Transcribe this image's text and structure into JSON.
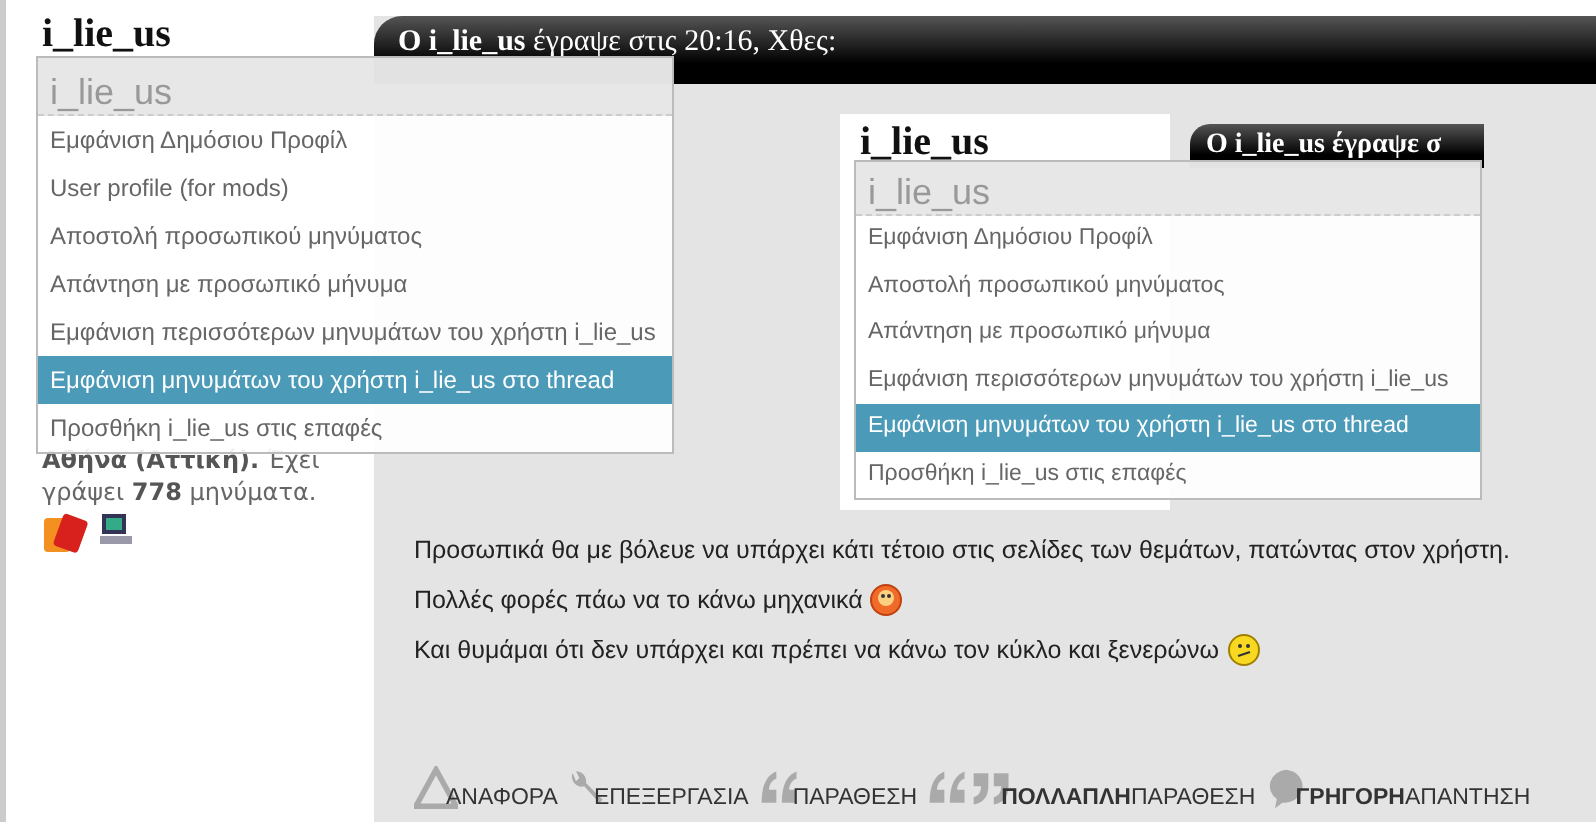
{
  "sidebar": {
    "username": "i_lie_us",
    "info": "**Αθήνα (Αττική).** Έχει γράψει **778** μηνύματα."
  },
  "user_menu": {
    "header": "i_lie_us",
    "items": [
      {
        "label": "Εμφάνιση Δημόσιου Προφίλ",
        "selected": false
      },
      {
        "label": "User profile (for mods)",
        "selected": false
      },
      {
        "label": "Αποστολή προσωπικού μηνύματος",
        "selected": false
      },
      {
        "label": "Απάντηση με προσωπικό μήνυμα",
        "selected": false
      },
      {
        "label": "Εμφάνιση περισσότερων μηνυμάτων του χρήστη i_lie_us",
        "selected": false
      },
      {
        "label": "Εμφάνιση μηνυμάτων του χρήστη i_lie_us στο thread",
        "selected": true
      },
      {
        "label": "Προσθήκη i_lie_us στις επαφές",
        "selected": false
      }
    ]
  },
  "post": {
    "header": "**Ο i_lie_us** έγραψε στις 20:16, Χθες:",
    "screenshot": {
      "username": "i_lie_us",
      "post_header": "Ο i_lie_us έγραψε σ",
      "menu": {
        "header": "i_lie_us",
        "items": [
          {
            "label": "Εμφάνιση Δημόσιου Προφίλ",
            "selected": false
          },
          {
            "label": "Αποστολή προσωπικού μηνύματος",
            "selected": false
          },
          {
            "label": "Απάντηση με προσωπικό μήνυμα",
            "selected": false
          },
          {
            "label": "Εμφάνιση περισσότερων μηνυμάτων του χρήστη i_lie_us",
            "selected": false
          },
          {
            "label": "Εμφάνιση μηνυμάτων του χρήστη i_lie_us στο thread",
            "selected": true
          },
          {
            "label": "Προσθήκη i_lie_us στις επαφές",
            "selected": false
          }
        ]
      }
    },
    "paragraphs": [
      {
        "kind": "plain",
        "text": "Προσωπικά θα με βόλευε να υπάρχει κάτι τέτοιο στις σελίδες των θεμάτων, πατώντας στον χρήστη."
      },
      {
        "kind": "embarrassed",
        "text": "Πολλές φορές πάω να το κάνω μηχανικά"
      },
      {
        "kind": "confused",
        "text": "Και θυμάμαι ότι δεν υπάρχει και πρέπει να κάνω τον κύκλο και ξενερώνω"
      }
    ],
    "buttons": [
      {
        "kind": "report",
        "label": "ΑΝΑΦΟΡΑ"
      },
      {
        "kind": "edit",
        "label": "ΕΠΕΞΕΡΓΑΣΙΑ"
      },
      {
        "kind": "quote",
        "label": "ΠΑΡΑΘΕΣΗ"
      },
      {
        "kind": "multiquote",
        "label": "**ΠΟΛΛΑΠΛΗ**ΠΑΡΑΘΕΣΗ"
      },
      {
        "kind": "reply",
        "label": "**ΓΡΗΓΟΡΗ**ΑΠΑΝΤΗΣΗ"
      }
    ]
  }
}
